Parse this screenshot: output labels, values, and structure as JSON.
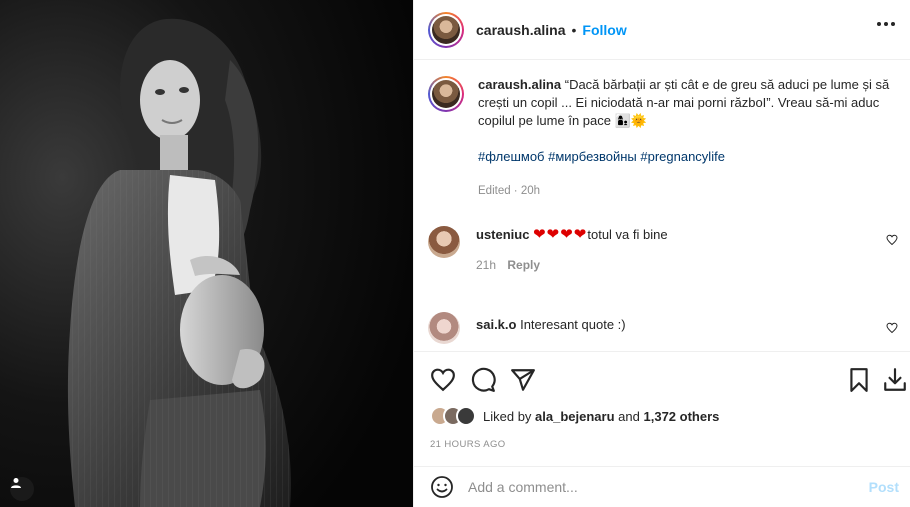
{
  "post": {
    "username": "caraush.alina",
    "follow_label": "Follow",
    "separator": "•"
  },
  "caption": {
    "username": "caraush.alina",
    "text": "“Dacă bărbații ar ști cât e de greu să aduci pe lume și să crești un copil ... Ei niciodată n-ar mai porni războI”. Vreau să-mi aduc copilul pe lume în pace 👩‍👦🌞",
    "hashtags": "#флешмоб #мирбезвойны #pregnancylife",
    "edited": "Edited · 20h"
  },
  "comments": [
    {
      "username": "usteniuc",
      "hearts": "❤❤❤❤",
      "text": "totul va fi bine",
      "time": "21h",
      "reply_label": "Reply"
    },
    {
      "username": "sai.k.o",
      "text": "Interesant quote :)"
    }
  ],
  "likes": {
    "prefix": "Liked by",
    "user": "ala_bejenaru",
    "middle": "and",
    "others": "1,372 others"
  },
  "timestamp": "21 HOURS AGO",
  "add_comment": {
    "placeholder": "Add a comment...",
    "post_label": "Post"
  },
  "colors": {
    "follow": "#0095f6",
    "hashtag": "#00376b",
    "muted": "#8e8e8e",
    "post_disabled": "#b2dffc"
  },
  "icons": [
    "user-tag-icon",
    "more-icon",
    "heart-icon",
    "comment-icon",
    "share-icon",
    "bookmark-icon",
    "download-icon",
    "emoji-icon"
  ]
}
